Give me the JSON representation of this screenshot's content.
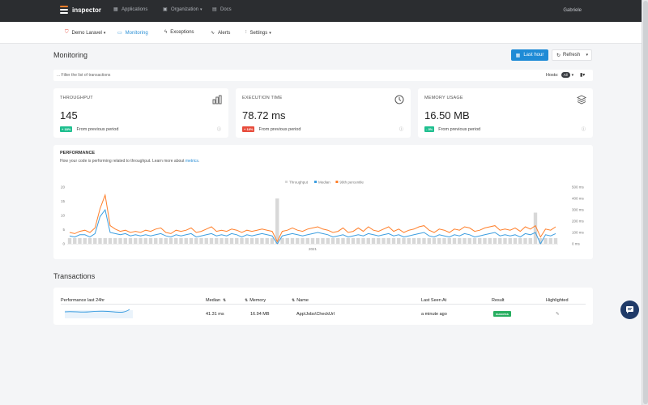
{
  "app": {
    "name": "inspector",
    "user": "Gabriele"
  },
  "topnav": [
    {
      "label": "Applications",
      "icon": "applications-icon"
    },
    {
      "label": "Organization",
      "icon": "organization-icon",
      "dropdown": true
    },
    {
      "label": "Docs",
      "icon": "docs-icon"
    }
  ],
  "subnav": {
    "project": "Demo Laravel",
    "items": [
      "Monitoring",
      "Exceptions",
      "Alerts",
      "Settings"
    ],
    "active": "Monitoring"
  },
  "page": {
    "title": "Monitoring",
    "time_range": "Last hour",
    "refresh_label": "Refresh",
    "filter_placeholder": "... Filter the list of transactions",
    "hosts_label": "Hosts:",
    "hosts_badge": "All"
  },
  "metrics": [
    {
      "title": "THROUGHPUT",
      "value": "145",
      "change": "+ 18%",
      "change_color": "#1fbf8f",
      "period": "From previous period",
      "icon": "bar-chart-icon"
    },
    {
      "title": "EXECUTION TIME",
      "value": "78.72 ms",
      "change": "+ 18%",
      "change_color": "#e74c3c",
      "period": "From previous period",
      "icon": "clock-icon"
    },
    {
      "title": "MEMORY USAGE",
      "value": "16.50 MB",
      "change": "- 3%",
      "change_color": "#1fbf8f",
      "period": "From previous period",
      "icon": "layers-icon"
    }
  ],
  "performance": {
    "title": "PERFORMANCE",
    "subtitle": "How your code is performing related to throughput. Learn more about",
    "link": "metrics"
  },
  "chart_data": {
    "type": "line",
    "legend": [
      "Throughput",
      "Median",
      "99th percentile"
    ],
    "legend_position": "top-center",
    "colors": {
      "throughput": "#d8d8d8",
      "median": "#3d9ee0",
      "p99": "#ff7f2a"
    },
    "yleft": {
      "ticks": [
        "20",
        "15",
        "10",
        "5",
        "0"
      ],
      "ylim": [
        0,
        20
      ]
    },
    "yright": {
      "ticks": [
        "500 ms",
        "400 ms",
        "300 ms",
        "200 ms",
        "100 ms",
        "0 ms"
      ],
      "ylim": [
        0,
        500
      ]
    },
    "x_tick_label": "2021",
    "x_tick_index": 48,
    "throughput": [
      2,
      2,
      2,
      2,
      2,
      2,
      2,
      2,
      2,
      2,
      2,
      2,
      2,
      2,
      2,
      2,
      2,
      2,
      2,
      2,
      2,
      2,
      2,
      2,
      2,
      2,
      2,
      2,
      2,
      2,
      2,
      2,
      2,
      2,
      2,
      2,
      2,
      2,
      2,
      2,
      2,
      16,
      2,
      2,
      2,
      2,
      2,
      2,
      2,
      2,
      2,
      2,
      2,
      2,
      2,
      2,
      2,
      2,
      2,
      2,
      2,
      2,
      2,
      2,
      2,
      2,
      2,
      2,
      2,
      2,
      2,
      2,
      2,
      2,
      2,
      2,
      2,
      2,
      2,
      2,
      2,
      2,
      2,
      2,
      2,
      2,
      2,
      2,
      2,
      2,
      2,
      2,
      11,
      2,
      2,
      2,
      2
    ],
    "median_ms": [
      70,
      60,
      80,
      80,
      60,
      90,
      240,
      300,
      100,
      90,
      80,
      90,
      70,
      80,
      70,
      80,
      70,
      80,
      90,
      70,
      60,
      80,
      70,
      80,
      90,
      60,
      70,
      80,
      90,
      70,
      80,
      70,
      90,
      80,
      60,
      80,
      70,
      80,
      90,
      80,
      70,
      -10,
      70,
      80,
      90,
      80,
      70,
      80,
      90,
      100,
      90,
      80,
      60,
      70,
      80,
      60,
      70,
      80,
      70,
      90,
      80,
      70,
      80,
      90,
      70,
      80,
      60,
      70,
      80,
      90,
      100,
      70,
      60,
      80,
      70,
      60,
      80,
      70,
      90,
      80,
      60,
      70,
      80,
      90,
      100,
      70,
      80,
      70,
      80,
      60,
      90,
      80,
      100,
      -10,
      80,
      70,
      90
    ],
    "p99_ms": [
      100,
      90,
      110,
      120,
      100,
      140,
      310,
      430,
      160,
      130,
      110,
      120,
      100,
      110,
      100,
      120,
      110,
      130,
      140,
      100,
      90,
      120,
      110,
      120,
      140,
      100,
      110,
      130,
      150,
      110,
      120,
      110,
      130,
      120,
      100,
      120,
      110,
      120,
      130,
      120,
      110,
      20,
      110,
      120,
      140,
      120,
      110,
      130,
      140,
      150,
      130,
      120,
      100,
      110,
      140,
      100,
      110,
      140,
      110,
      150,
      120,
      110,
      130,
      150,
      110,
      130,
      100,
      120,
      130,
      150,
      160,
      120,
      100,
      130,
      120,
      100,
      130,
      120,
      150,
      140,
      110,
      120,
      140,
      150,
      160,
      120,
      130,
      120,
      140,
      110,
      150,
      130,
      160,
      60,
      130,
      120,
      150
    ]
  },
  "transactions": {
    "title": "Transactions",
    "headers": [
      "Performance last 24hr",
      "Median",
      "Memory",
      "Name",
      "Last Seen At",
      "Result",
      "Highlighted"
    ],
    "rows": [
      {
        "median": "41.31 ms",
        "memory": "16.94 MB",
        "name": "App\\Jobs\\CheckUrl",
        "last_seen": "a minute ago",
        "result": "success"
      }
    ]
  }
}
